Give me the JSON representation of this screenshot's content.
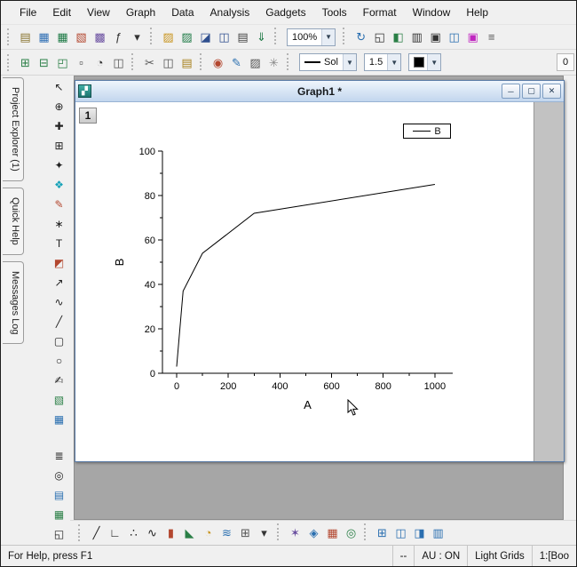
{
  "menu": {
    "items": [
      {
        "name": "menu-file",
        "label": "File"
      },
      {
        "name": "menu-edit",
        "label": "Edit"
      },
      {
        "name": "menu-view",
        "label": "View"
      },
      {
        "name": "menu-graph",
        "label": "Graph"
      },
      {
        "name": "menu-data",
        "label": "Data"
      },
      {
        "name": "menu-analysis",
        "label": "Analysis"
      },
      {
        "name": "menu-gadgets",
        "label": "Gadgets"
      },
      {
        "name": "menu-tools",
        "label": "Tools"
      },
      {
        "name": "menu-format",
        "label": "Format"
      },
      {
        "name": "menu-window",
        "label": "Window"
      },
      {
        "name": "menu-help",
        "label": "Help"
      }
    ]
  },
  "toolbar1": {
    "zoom_value": "100%",
    "items_left": [
      {
        "name": "new-project-button",
        "glyph": "▤",
        "color": "#8a7632"
      },
      {
        "name": "new-workbook-button",
        "glyph": "▦",
        "color": "#2f6fb4"
      },
      {
        "name": "new-excel-button",
        "glyph": "▦",
        "color": "#1e7a46"
      },
      {
        "name": "new-graph-button",
        "glyph": "▧",
        "color": "#b3472f"
      },
      {
        "name": "new-matrix-button",
        "glyph": "▩",
        "color": "#6a4fa0"
      },
      {
        "name": "new-function-graph-button",
        "glyph": "ƒ",
        "color": "#333333"
      },
      {
        "name": "new-more-button",
        "glyph": "▾",
        "color": "#333333"
      },
      {
        "sep": true
      },
      {
        "name": "open-button",
        "glyph": "▨",
        "color": "#c8941e"
      },
      {
        "name": "open-excel-button",
        "glyph": "▨",
        "color": "#1e7a46"
      },
      {
        "name": "save-project-button",
        "glyph": "◪",
        "color": "#2f4f8f"
      },
      {
        "name": "save-window-button",
        "glyph": "◫",
        "color": "#2f4f8f"
      },
      {
        "name": "print-button",
        "glyph": "▤",
        "color": "#444444"
      },
      {
        "name": "import-wizard-button",
        "glyph": "⇓",
        "color": "#1e7a46"
      },
      {
        "sep": true
      }
    ],
    "items_right": [
      {
        "sep": true
      },
      {
        "name": "refresh-button",
        "glyph": "↻",
        "color": "#2a6fb0"
      },
      {
        "name": "full-screen-button",
        "glyph": "◱",
        "color": "#333333"
      },
      {
        "name": "project-explorer-toggle",
        "glyph": "◧",
        "color": "#2a7f46"
      },
      {
        "name": "results-log-toggle",
        "glyph": "▥",
        "color": "#333333"
      },
      {
        "name": "command-window-toggle",
        "glyph": "▣",
        "color": "#333333"
      },
      {
        "name": "arrange-windows-button",
        "glyph": "◫",
        "color": "#2a6fb0"
      },
      {
        "name": "theme-gallery-button",
        "glyph": "▣",
        "color": "#c026c0"
      },
      {
        "name": "toolbar-options-button",
        "glyph": "≡",
        "color": "#555555"
      }
    ]
  },
  "toolbar2": {
    "line_style": "Sol",
    "line_width": "1.5",
    "line_color": "#000000",
    "zero_value": "0",
    "items_left": [
      {
        "name": "add-layer-button",
        "glyph": "⊞",
        "color": "#2a7f46"
      },
      {
        "name": "add-right-y-layer-button",
        "glyph": "⊟",
        "color": "#2a7f46"
      },
      {
        "name": "add-inset-layer-button",
        "glyph": "◰",
        "color": "#2a7f46"
      },
      {
        "name": "new-legend-button",
        "glyph": "▫",
        "color": "#333333"
      },
      {
        "name": "date-time-stamp-button",
        "glyph": "◔",
        "color": "#333333"
      },
      {
        "name": "layer-properties-button",
        "glyph": "◫",
        "color": "#555555"
      },
      {
        "sep": true
      },
      {
        "name": "cut-button",
        "glyph": "✂",
        "color": "#555555"
      },
      {
        "name": "copy-button",
        "glyph": "◫",
        "color": "#555555"
      },
      {
        "name": "paste-button",
        "glyph": "▤",
        "color": "#a8821e"
      },
      {
        "sep": true
      },
      {
        "name": "fill-color-button",
        "glyph": "◉",
        "color": "#b3472f"
      },
      {
        "name": "line-color-button",
        "glyph": "✎",
        "color": "#2a6fb0"
      },
      {
        "name": "pattern-button",
        "glyph": "▨",
        "color": "#555555"
      },
      {
        "name": "effects-button",
        "glyph": "✳",
        "color": "#888888"
      },
      {
        "sep": true
      }
    ]
  },
  "side_tabs": {
    "items": [
      {
        "name": "tab-project-explorer",
        "label": "Project Explorer (1)"
      },
      {
        "name": "tab-quick-help",
        "label": "Quick Help"
      },
      {
        "name": "tab-messages-log",
        "label": "Messages Log"
      }
    ]
  },
  "tools": {
    "top": [
      {
        "name": "pointer-tool",
        "glyph": "↖",
        "color": "#222222"
      },
      {
        "name": "zoom-in-tool",
        "glyph": "⊕",
        "color": "#222222"
      },
      {
        "name": "zoom-pan-tool",
        "glyph": "✚",
        "color": "#222222"
      },
      {
        "name": "scale-in-tool",
        "glyph": "⊞",
        "color": "#222222"
      },
      {
        "name": "selection-tool",
        "glyph": "✦",
        "color": "#222222"
      },
      {
        "name": "regional-mask-tool",
        "glyph": "❖",
        "color": "#17a2b8"
      },
      {
        "name": "draw-data-tool",
        "glyph": "✎",
        "color": "#b3472f"
      },
      {
        "name": "data-reader-tool",
        "glyph": "∗",
        "color": "#222222"
      },
      {
        "name": "text-tool",
        "glyph": "T",
        "color": "#222222"
      },
      {
        "name": "object-edit-tool",
        "glyph": "◩",
        "color": "#b3472f"
      },
      {
        "name": "arrow-tool",
        "glyph": "↗",
        "color": "#222222"
      },
      {
        "name": "curved-arrow-tool",
        "glyph": "∿",
        "color": "#222222"
      },
      {
        "name": "line-tool",
        "glyph": "╱",
        "color": "#222222"
      },
      {
        "name": "rectangle-tool",
        "glyph": "▢",
        "color": "#222222"
      },
      {
        "name": "circle-tool",
        "glyph": "○",
        "color": "#222222"
      },
      {
        "name": "freehand-tool",
        "glyph": "✍",
        "color": "#222222"
      },
      {
        "name": "insert-graph-tool",
        "glyph": "▧",
        "color": "#2a7f46"
      },
      {
        "name": "insert-worksheet-tool",
        "glyph": "▦",
        "color": "#2a6fb0"
      }
    ],
    "bottom": [
      {
        "name": "object-manager-button",
        "glyph": "≣",
        "color": "#222222"
      },
      {
        "name": "layer-display-button",
        "glyph": "◎",
        "color": "#222222"
      },
      {
        "name": "apps-button",
        "glyph": "▤",
        "color": "#2a6fb0"
      },
      {
        "name": "add-object-button",
        "glyph": "▦",
        "color": "#2a7f46"
      },
      {
        "name": "fit-page-button",
        "glyph": "◱",
        "color": "#222222"
      }
    ]
  },
  "window": {
    "title": "Graph1 *",
    "page_number": "1",
    "buttons": [
      {
        "name": "minimize-button",
        "glyph": "─"
      },
      {
        "name": "maximize-button",
        "glyph": "▢"
      },
      {
        "name": "close-button",
        "glyph": "✕"
      }
    ]
  },
  "bottom_toolbar": {
    "items": [
      {
        "name": "line-plot-button",
        "glyph": "╱",
        "color": "#222222"
      },
      {
        "name": "horizontal-step-button",
        "glyph": "∟",
        "color": "#222222"
      },
      {
        "name": "scatter-plot-button",
        "glyph": "∴",
        "color": "#222222"
      },
      {
        "name": "line-symbol-button",
        "glyph": "∿",
        "color": "#222222"
      },
      {
        "name": "column-plot-button",
        "glyph": "▮",
        "color": "#b3472f"
      },
      {
        "name": "area-plot-button",
        "glyph": "◣",
        "color": "#2a7f46"
      },
      {
        "name": "pie-chart-button",
        "glyph": "◔",
        "color": "#c8941e"
      },
      {
        "name": "stacked-plot-button",
        "glyph": "≋",
        "color": "#2a6fb0"
      },
      {
        "name": "multi-panel-button",
        "glyph": "⊞",
        "color": "#555555"
      },
      {
        "name": "template-library-button",
        "glyph": "▾",
        "color": "#333333"
      },
      {
        "sep": true
      },
      {
        "name": "3d-scatter-button",
        "glyph": "✶",
        "color": "#6a4fa0"
      },
      {
        "name": "3d-surface-button",
        "glyph": "◈",
        "color": "#2a6fb0"
      },
      {
        "name": "3d-bars-button",
        "glyph": "▦",
        "color": "#b3472f"
      },
      {
        "name": "contour-button",
        "glyph": "◎",
        "color": "#2a7f46"
      },
      {
        "sep": true
      },
      {
        "name": "add-xy-layer-button",
        "glyph": "⊞",
        "color": "#2a6fb0"
      },
      {
        "name": "merge-graphs-button",
        "glyph": "◫",
        "color": "#2a6fb0"
      },
      {
        "name": "extract-layers-button",
        "glyph": "◨",
        "color": "#2a6fb0"
      },
      {
        "name": "layer-arrange-button",
        "glyph": "▥",
        "color": "#2a6fb0"
      }
    ]
  },
  "statusbar": {
    "help": "For Help, press F1",
    "cells": [
      {
        "name": "status-placeholder",
        "label": "--"
      },
      {
        "name": "status-autoupdate",
        "label": "AU : ON"
      },
      {
        "name": "status-theme",
        "label": "Light Grids"
      },
      {
        "name": "status-active-window",
        "label": "1:[Boo"
      }
    ]
  },
  "chart_data": {
    "type": "line",
    "title": "",
    "xlabel": "A",
    "ylabel": "B",
    "xlim": [
      -55,
      1069
    ],
    "ylim": [
      0,
      100
    ],
    "xticks": [
      0,
      200,
      400,
      600,
      800,
      1000
    ],
    "yticks": [
      0,
      20,
      40,
      60,
      80,
      100
    ],
    "grid": false,
    "legend_position": "top-right",
    "series": [
      {
        "name": "B",
        "color": "#000000",
        "x": [
          0,
          25,
          100,
          300,
          1000
        ],
        "y": [
          3,
          37,
          54,
          72,
          85
        ]
      }
    ]
  }
}
